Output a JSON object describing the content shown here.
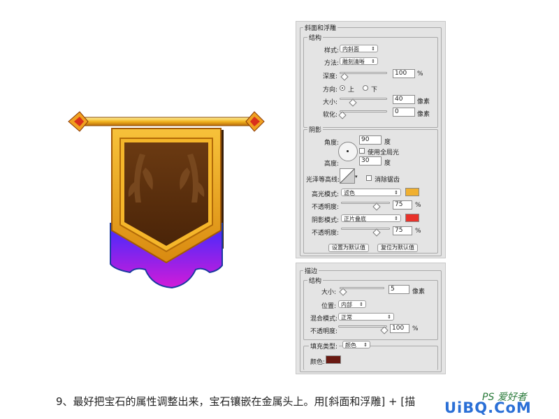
{
  "bevel_panel": {
    "section_title": "斜面和浮雕",
    "structure_title": "结构",
    "style_label": "样式:",
    "style_value": "内斜面",
    "method_label": "方法:",
    "method_value": "雕刻清晰",
    "depth_label": "深度:",
    "depth_value": "100",
    "depth_unit": "%",
    "direction_label": "方向:",
    "direction_up": "上",
    "direction_down": "下",
    "size_label": "大小:",
    "size_value": "40",
    "size_unit": "像素",
    "soften_label": "软化:",
    "soften_value": "0",
    "soften_unit": "像素",
    "shading_title": "阴影",
    "angle_label": "角度:",
    "angle_value": "90",
    "angle_unit": "度",
    "global_light_label": "使用全局光",
    "altitude_label": "高度:",
    "altitude_value": "30",
    "altitude_unit": "度",
    "gloss_label": "光泽等高线:",
    "antialias_label": "消除锯齿",
    "highlight_mode_label": "高光模式:",
    "highlight_mode_value": "滤色",
    "highlight_color": "#f0b030",
    "highlight_opacity_label": "不透明度:",
    "highlight_opacity_value": "75",
    "highlight_opacity_unit": "%",
    "shadow_mode_label": "阴影模式:",
    "shadow_mode_value": "正片叠底",
    "shadow_color": "#e8322a",
    "shadow_opacity_label": "不透明度:",
    "shadow_opacity_value": "75",
    "shadow_opacity_unit": "%",
    "make_default": "设置为默认值",
    "reset_default": "复位为默认值"
  },
  "stroke_panel": {
    "section_title": "描边",
    "structure_title": "结构",
    "size_label": "大小:",
    "size_value": "5",
    "size_unit": "像素",
    "position_label": "位置:",
    "position_value": "内部",
    "blend_label": "混合模式:",
    "blend_value": "正常",
    "opacity_label": "不透明度:",
    "opacity_value": "100",
    "opacity_unit": "%",
    "fill_type_label": "填充类型:",
    "fill_type_value": "颜色",
    "color_label": "颜色:",
    "color_value": "#6a1a12"
  },
  "caption": {
    "text": "9、最好把宝石的属性调整出来，宝石镶嵌在金属头上。用[斜面和浮雕] + [描"
  },
  "watermark": {
    "brand": "PS 爱好者",
    "site": "UiBQ.CoM"
  },
  "slider_positions": {
    "depth": 0.05,
    "size": 0.25,
    "soften": 0.0,
    "highlight_opacity": 0.75,
    "shadow_opacity": 0.75,
    "stroke_size": 0.02,
    "stroke_opacity": 1.0
  }
}
